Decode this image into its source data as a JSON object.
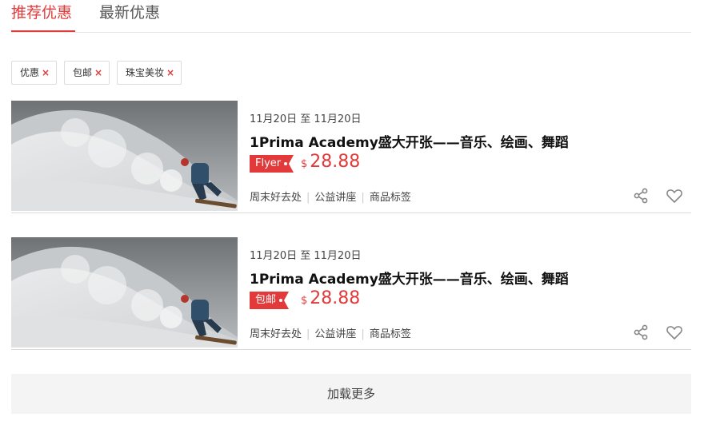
{
  "tabs": [
    {
      "label": "推荐优惠",
      "active": true
    },
    {
      "label": "最新优惠",
      "active": false
    }
  ],
  "filters": [
    {
      "label": "优惠"
    },
    {
      "label": "包邮"
    },
    {
      "label": "珠宝美妆"
    }
  ],
  "remove_symbol": "×",
  "cards": [
    {
      "date_start": "11月20日",
      "date_sep": "至",
      "date_end": "11月20日",
      "title": "1Prima Academy盛大开张——音乐、绘画、舞蹈",
      "badge": "Flyer",
      "currency": "$",
      "price": "28.88",
      "categories": [
        "周末好去处",
        "公益讲座",
        "商品标签"
      ]
    },
    {
      "date_start": "11月20日",
      "date_sep": "至",
      "date_end": "11月20日",
      "title": "1Prima Academy盛大开张——音乐、绘画、舞蹈",
      "badge": "包邮",
      "currency": "$",
      "price": "28.88",
      "categories": [
        "周末好去处",
        "公益讲座",
        "商品标签"
      ]
    }
  ],
  "load_more": "加载更多",
  "icons": {
    "share": "share-icon",
    "favorite": "heart-icon"
  },
  "colors": {
    "accent": "#e23a3a",
    "text": "#333333",
    "border": "#dddddd",
    "load_bg": "#f4f4f4"
  }
}
